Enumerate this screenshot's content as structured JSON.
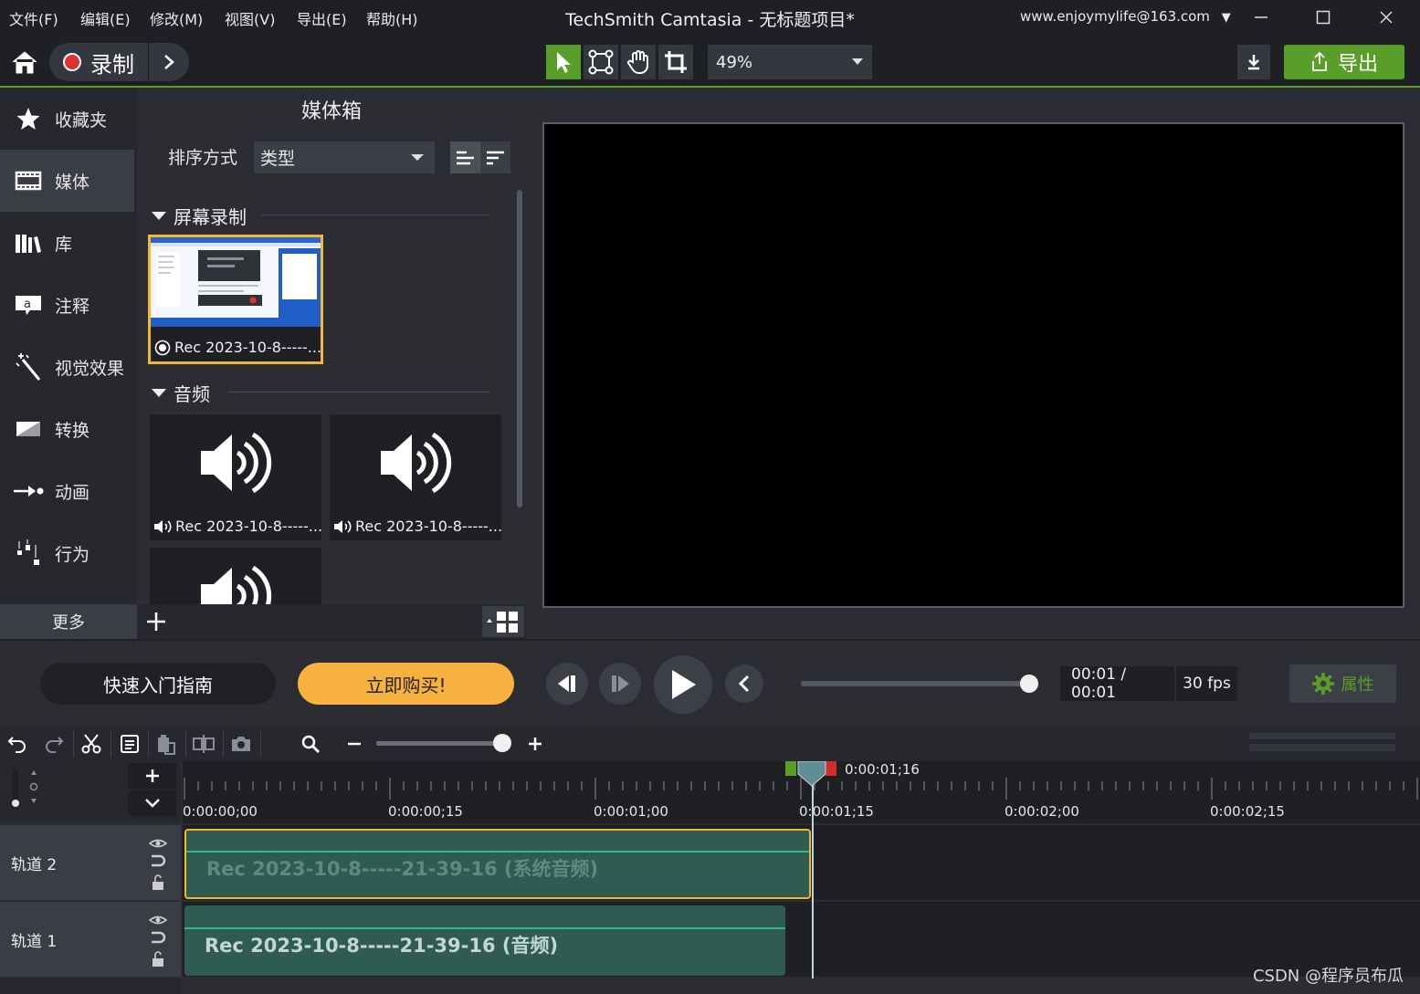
{
  "menu": [
    "文件(F)",
    "编辑(E)",
    "修改(M)",
    "视图(V)",
    "导出(E)",
    "帮助(H)"
  ],
  "app_title": "TechSmith Camtasia - 无标题项目*",
  "account": "www.enjoymylife@163.com",
  "account_caret": "▼",
  "toolbar": {
    "record_label": "录制",
    "zoom_value": "49%",
    "export_label": "导出"
  },
  "nav": [
    {
      "label": "收藏夹",
      "icon": "star-icon"
    },
    {
      "label": "媒体",
      "icon": "film-icon"
    },
    {
      "label": "库",
      "icon": "library-icon"
    },
    {
      "label": "注释",
      "icon": "annotation-icon"
    },
    {
      "label": "视觉效果",
      "icon": "magic-wand-icon"
    },
    {
      "label": "转换",
      "icon": "transition-icon"
    },
    {
      "label": "动画",
      "icon": "animation-icon"
    },
    {
      "label": "行为",
      "icon": "behavior-icon"
    }
  ],
  "nav_more": "更多",
  "media_bin": {
    "title": "媒体箱",
    "sort_label": "排序方式",
    "sort_value": "类型",
    "sections": {
      "screen": "屏幕录制",
      "audio": "音频"
    },
    "items": {
      "screen_rec": "Rec 2023-10-8-----...",
      "audio_1": "Rec 2023-10-8-----...",
      "audio_2": "Rec 2023-10-8-----..."
    }
  },
  "playback": {
    "guide_label": "快速入门指南",
    "buy_label": "立即购买!",
    "time": "00:01 / 00:01",
    "fps": "30 fps",
    "props_label": "属性",
    "scrub_progress": 1.0
  },
  "timeline": {
    "playhead_time": "0:00:01;16",
    "ticks": [
      "0:00:00;00",
      "0:00:00;15",
      "0:00:01;00",
      "0:00:01;15",
      "0:00:02;00",
      "0:00:02;15"
    ],
    "tracks": [
      {
        "name": "轨道 2",
        "clip": "Rec 2023-10-8-----21-39-16 (系统音频)"
      },
      {
        "name": "轨道 1",
        "clip": "Rec 2023-10-8-----21-39-16 (音频)"
      }
    ]
  },
  "watermark": "CSDN @程序员布瓜",
  "colors": {
    "accent_green": "#5a9e2a",
    "buy_orange": "#f6b13e",
    "selected_border": "#f2b731",
    "clip_fill": "#2f5b52",
    "record_red": "#e03131"
  }
}
